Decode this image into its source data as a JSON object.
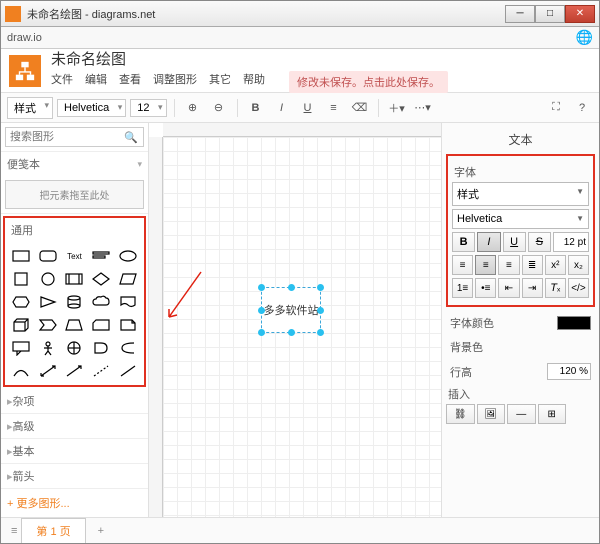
{
  "window": {
    "title": "未命名绘图 - diagrams.net"
  },
  "addr": "draw.io",
  "doc": {
    "title": "未命名绘图"
  },
  "menu": {
    "file": "文件",
    "edit": "编辑",
    "view": "查看",
    "arrange": "调整图形",
    "extras": "其它",
    "help": "帮助"
  },
  "save_warning": "修改未保存。点击此处保存。",
  "toolbar": {
    "style": "样式",
    "font": "Helvetica",
    "fontsize": "12"
  },
  "sidebar": {
    "search_placeholder": "搜索图形",
    "scratchpad": "便笺本",
    "dropzone": "把元素拖至此处",
    "general": "通用",
    "misc": "杂项",
    "advanced": "高级",
    "basic": "基本",
    "arrows": "箭头",
    "more": "+ 更多图形..."
  },
  "canvas": {
    "text": "多多软件站"
  },
  "rightpanel": {
    "title": "文本",
    "font_label": "字体",
    "style": "样式",
    "fontname": "Helvetica",
    "size": "12 pt",
    "fontcolor": "字体颜色",
    "bgcolor": "背景色",
    "lineheight": "行高",
    "lineheight_val": "120 %",
    "insert": "插入"
  },
  "tabs": {
    "page1": "第 1 页"
  }
}
